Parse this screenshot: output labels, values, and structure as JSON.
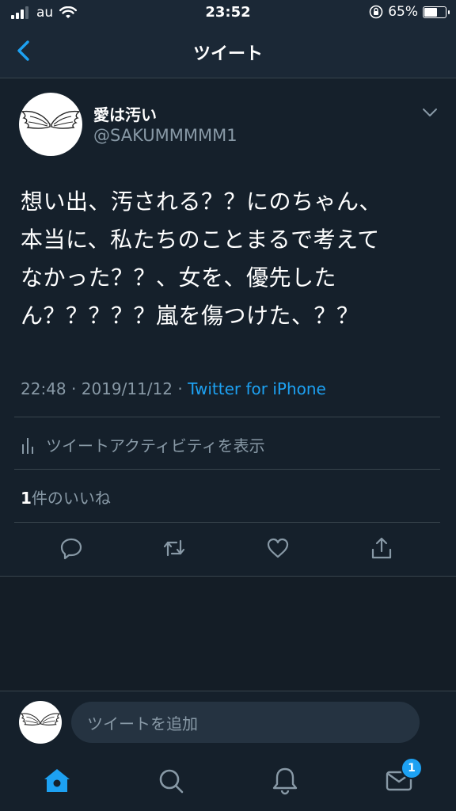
{
  "status_bar": {
    "carrier": "au",
    "time": "23:52",
    "battery_percent": "65%",
    "battery_level": 0.65
  },
  "nav": {
    "title": "ツイート"
  },
  "tweet": {
    "display_name": "愛は汚い",
    "handle": "@SAKUMMMMM1",
    "text": "想い出、汚される？？にのちゃん、\n本当に、私たちのことまるで考えて\nなかった？？、女を、優先したん？？？？？嵐を傷つけた、？？",
    "time": "22:48",
    "separator": "·",
    "date": "2019/11/12",
    "source": "Twitter for iPhone",
    "activity_label": "ツイートアクティビティを表示",
    "like_count": "1",
    "like_label": "件のいいね"
  },
  "reply": {
    "placeholder": "ツイートを追加"
  },
  "tabs": {
    "messages_badge": "1"
  },
  "colors": {
    "accent": "#1da1f2",
    "background": "#15202b",
    "bar": "#1b2836",
    "muted_text": "#8899a6",
    "divider": "#38444d"
  }
}
